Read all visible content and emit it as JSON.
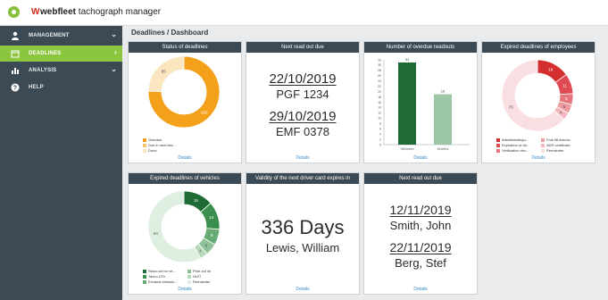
{
  "app": {
    "brand": "webfleet",
    "product": "tachograph manager"
  },
  "sidebar": {
    "items": [
      {
        "label": "MANAGEMENT",
        "icon": "person-icon",
        "expandable": true,
        "active": false
      },
      {
        "label": "DEADLINES",
        "icon": "calendar-icon",
        "expandable": true,
        "active": true
      },
      {
        "label": "ANALYSIS",
        "icon": "bar-chart-icon",
        "expandable": true,
        "active": false
      },
      {
        "label": "HELP",
        "icon": "help-icon",
        "expandable": false,
        "active": false
      }
    ]
  },
  "breadcrumb": "Deadlines / Dashboard",
  "colors": {
    "sidebar": "#3b4a55",
    "accent": "#8cc63f",
    "orange": "#f5a01a",
    "dark_green": "#1f6b35",
    "red": "#d32f2f"
  },
  "cards": {
    "status": {
      "title": "Status of deadlines",
      "details": "Details",
      "legend": [
        "Overdue",
        "Due in next few...",
        "Done"
      ]
    },
    "next_read_out": {
      "title": "Next read out due",
      "details": "Details",
      "entries": [
        {
          "date": "22/10/2019",
          "name": "PGF 1234"
        },
        {
          "date": "29/10/2019",
          "name": "EMF 0378"
        }
      ]
    },
    "overdue": {
      "title": "Number of overdue readouts",
      "details": "Details"
    },
    "employees": {
      "title": "Expired deadlines of employees",
      "details": "Details",
      "legend": [
        "Arbeitsbedingu...",
        "Expiration of dri...",
        "Verification driv...",
        "Fork lift licence",
        "ADR certificate",
        "Remainder"
      ]
    },
    "vehicles": {
      "title": "Expired deadlines of vehicles",
      "details": "Details",
      "legend": [
        "Read out for ve...",
        "Tacho UTh",
        "Exhaust emissio...",
        "Print out lot",
        "HU/T",
        "Remainder"
      ]
    },
    "validity": {
      "title": "Validity of the next driver card expires in",
      "details": "Details",
      "value": "336 Days",
      "name": "Lewis, William"
    },
    "next_read_out_2": {
      "title": "Next read out due",
      "details": "Details",
      "entries": [
        {
          "date": "12/11/2019",
          "name": "Smith, John"
        },
        {
          "date": "22/11/2019",
          "name": "Berg, Stef"
        }
      ]
    }
  },
  "chart_data": [
    {
      "type": "pie",
      "title": "Status of deadlines",
      "labels": [
        "Overdue",
        "Due in next few...",
        "Done"
      ],
      "values": [
        260,
        0,
        85
      ],
      "colors": [
        "#f5a01a",
        "#f7c46a",
        "#fbe6bf"
      ]
    },
    {
      "type": "bar",
      "title": "Number of overdue readouts",
      "categories": [
        "Vehicles",
        "Drivers"
      ],
      "values": [
        31,
        19
      ],
      "ylim": [
        0,
        32
      ],
      "yticks": [
        0,
        2,
        4,
        6,
        8,
        10,
        12,
        14,
        16,
        18,
        20,
        22,
        24,
        26,
        28,
        30,
        32
      ],
      "colors": [
        "#1f6b35",
        "#9cc7a6"
      ]
    },
    {
      "type": "pie",
      "title": "Expired deadlines of employees",
      "labels": [
        "Arbeitsbedingu...",
        "Expiration of dri...",
        "Verification driv...",
        "Fork lift licence",
        "ADR certificate",
        "Remainder"
      ],
      "values": [
        18,
        11,
        6,
        5,
        4,
        76
      ],
      "data_labels": [
        "18",
        "11",
        "6",
        "5",
        "4",
        "76"
      ],
      "colors": [
        "#d32f2f",
        "#e04a52",
        "#e8737b",
        "#ef9aa1",
        "#f3b8bd",
        "#f9dfe1"
      ]
    },
    {
      "type": "pie",
      "title": "Expired deadlines of vehicles",
      "labels": [
        "Read out for ve...",
        "Tacho UTh",
        "Exhaust emissio...",
        "Print out lot",
        "HU/T",
        "Remainder"
      ],
      "values": [
        15,
        14,
        8,
        6,
        4,
        64
      ],
      "data_labels": [
        "15",
        "14",
        "8",
        "6",
        "4",
        "64"
      ],
      "colors": [
        "#1f6b35",
        "#3a8f4e",
        "#66aa73",
        "#8fc197",
        "#b6d8bb",
        "#deeee0"
      ]
    }
  ]
}
